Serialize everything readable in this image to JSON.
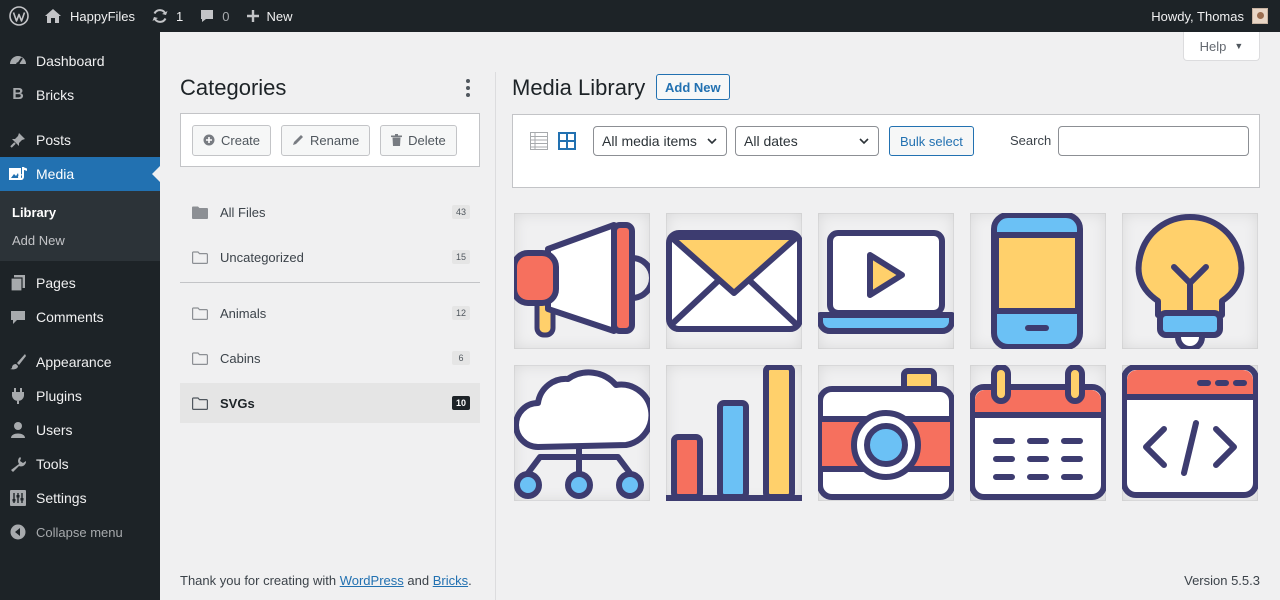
{
  "adminbar": {
    "site_name": "HappyFiles",
    "updates_count": "1",
    "comments_count": "0",
    "new_label": "New",
    "howdy": "Howdy, Thomas"
  },
  "sidebar": {
    "items": [
      {
        "label": "Dashboard",
        "icon": "dashboard-icon"
      },
      {
        "label": "Bricks",
        "icon": "bricks-icon"
      },
      {
        "label": "Posts",
        "icon": "pin-icon"
      },
      {
        "label": "Media",
        "icon": "media-icon"
      },
      {
        "label": "Pages",
        "icon": "pages-icon"
      },
      {
        "label": "Comments",
        "icon": "comments-icon"
      },
      {
        "label": "Appearance",
        "icon": "brush-icon"
      },
      {
        "label": "Plugins",
        "icon": "plug-icon"
      },
      {
        "label": "Users",
        "icon": "users-icon"
      },
      {
        "label": "Tools",
        "icon": "wrench-icon"
      },
      {
        "label": "Settings",
        "icon": "settings-icon"
      }
    ],
    "submenu": [
      "Library",
      "Add New"
    ],
    "collapse": "Collapse menu"
  },
  "help": "Help",
  "categories": {
    "title": "Categories",
    "create": "Create",
    "rename": "Rename",
    "delete": "Delete",
    "list": [
      {
        "label": "All Files",
        "count": "43"
      },
      {
        "label": "Uncategorized",
        "count": "15"
      },
      {
        "label": "Animals",
        "count": "12"
      },
      {
        "label": "Cabins",
        "count": "6"
      },
      {
        "label": "SVGs",
        "count": "10"
      }
    ]
  },
  "media": {
    "title": "Media Library",
    "add_new": "Add New",
    "filter_type": "All media items",
    "filter_date": "All dates",
    "bulk_select": "Bulk select",
    "search_label": "Search",
    "search_value": "",
    "thumbnails": [
      "megaphone-icon",
      "envelope-icon",
      "laptop-video-icon",
      "smartphone-icon",
      "lightbulb-icon",
      "cloud-network-icon",
      "bar-chart-icon",
      "camera-icon",
      "calendar-icon",
      "code-window-icon"
    ]
  },
  "footer": {
    "text_before": "Thank you for creating with ",
    "link1": "WordPress",
    "text_mid": " and ",
    "link2": "Bricks",
    "text_after": ".",
    "version": "Version 5.5.3"
  },
  "colors": {
    "accent": "#2271b1",
    "sidebar": "#1d2327",
    "illustration_outline": "#3d3c70",
    "illustration_red": "#f6705e",
    "illustration_yellow": "#ffd06b",
    "illustration_blue": "#6bc1f5"
  }
}
